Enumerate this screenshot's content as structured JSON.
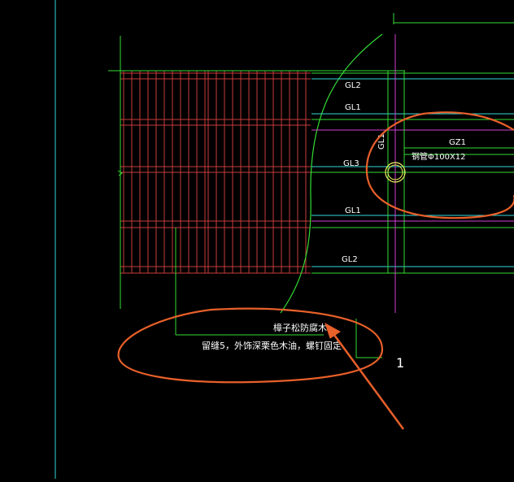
{
  "drawing": {
    "beam_labels": {
      "gl2_top": "GL2",
      "gl1_upper": "GL1",
      "gl3": "GL3",
      "gl1_lower": "GL1",
      "gl2_bottom": "GL2",
      "gz1": "GZ1",
      "gl1_vertical": "GL1"
    },
    "steel_pipe_label": "钢管Φ100X12",
    "note": {
      "line1": "樟子松防腐木",
      "line2": "留缝5，外饰深栗色木油，螺钉固定"
    },
    "section_mark": "1",
    "colors": {
      "background": "#000000",
      "grid_red": "#c83c3c",
      "green": "#33dd33",
      "cyan": "#33d8d8",
      "magenta": "#d040d0",
      "annotation_orange": "#e8602a",
      "pipe_yellow": "#f0f060"
    }
  }
}
